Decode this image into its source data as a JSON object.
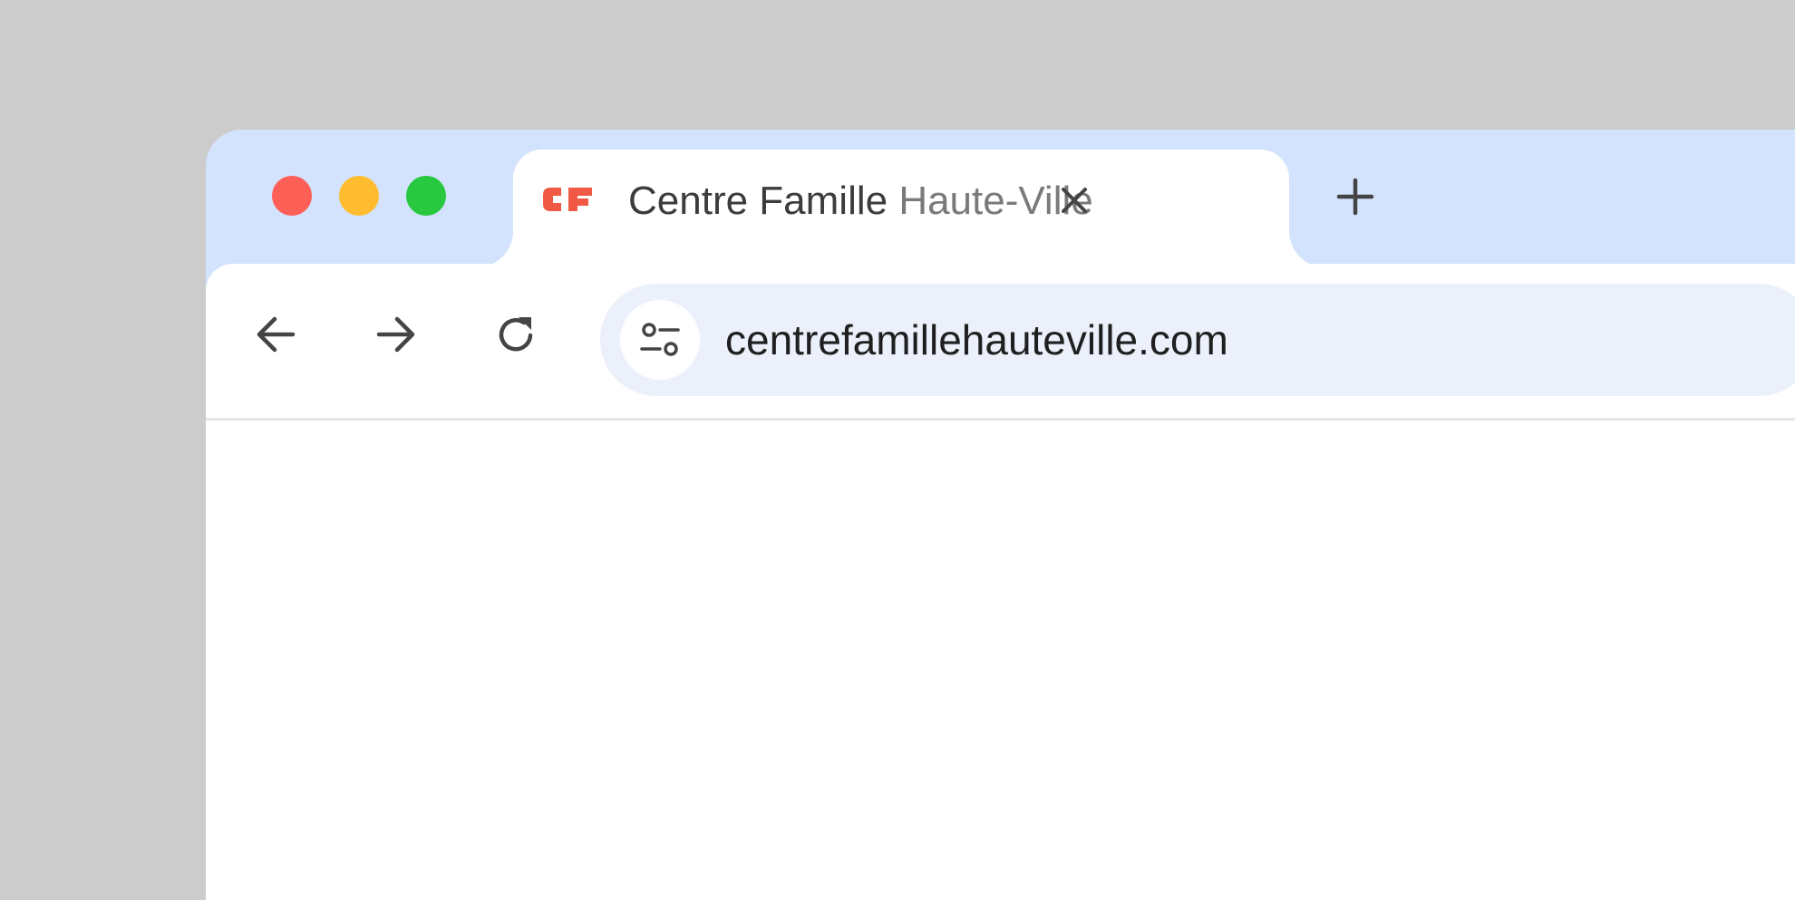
{
  "window": {
    "traffic_lights": {
      "close_color": "#fe5f57",
      "minimize_color": "#febc2e",
      "maximize_color": "#28c840"
    }
  },
  "tab": {
    "favicon": {
      "icon": "cf-logo-icon",
      "text": "CF",
      "color": "#f05a45"
    },
    "title_main": "Centre Famille ",
    "title_faded": "Haute-Ville",
    "close_icon": "close-icon"
  },
  "new_tab": {
    "icon": "plus-icon"
  },
  "toolbar": {
    "back_icon": "arrow-left-icon",
    "forward_icon": "arrow-right-icon",
    "reload_icon": "reload-icon"
  },
  "omnibox": {
    "site_info_icon": "tune-icon",
    "url": "centrefamillehauteville.com"
  },
  "colors": {
    "tabstrip_bg": "#d3e3fd",
    "omnibox_bg": "#ebf0fa",
    "icon_color": "#444444"
  }
}
